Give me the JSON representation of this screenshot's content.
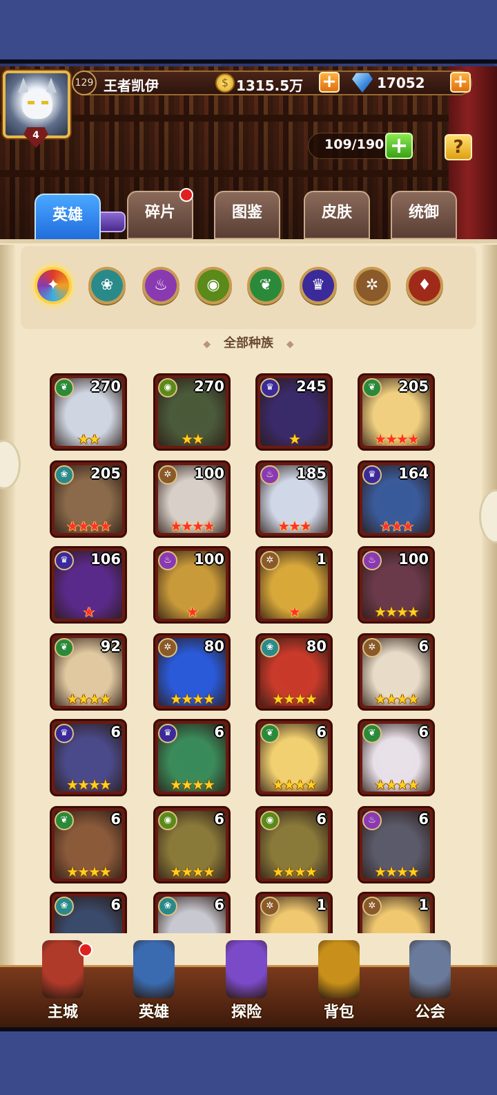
{
  "player": {
    "level": "129",
    "name": "王者凯伊",
    "avatar_rank": "4",
    "gold": "1315.5万",
    "diamonds": "17052"
  },
  "hero_capacity": "109/190",
  "help_label": "?",
  "tabs": [
    {
      "label": "英雄",
      "active": true
    },
    {
      "label": "碎片",
      "has_notification": true
    },
    {
      "label": "图鉴"
    },
    {
      "label": "皮肤"
    },
    {
      "label": "统御"
    }
  ],
  "race_filters": [
    {
      "name": "all-races",
      "icon": "✦",
      "color": "#e0562a",
      "selected": true
    },
    {
      "name": "race-teal",
      "icon": "❀",
      "color": "#2a8a8a"
    },
    {
      "name": "race-purple",
      "icon": "♨",
      "color": "#8a3ab0"
    },
    {
      "name": "race-green-eye",
      "icon": "◉",
      "color": "#5a8a1a"
    },
    {
      "name": "race-leaf",
      "icon": "❦",
      "color": "#2a8a3a"
    },
    {
      "name": "race-demon",
      "icon": "♛",
      "color": "#3a2a9a"
    },
    {
      "name": "race-light",
      "icon": "✲",
      "color": "#8a5a2a"
    },
    {
      "name": "race-dark",
      "icon": "♦",
      "color": "#a02a1a"
    }
  ],
  "selected_race_label": "全部种族",
  "heroes": [
    {
      "level": "270",
      "stars": "★★",
      "red": false,
      "faction": "❦",
      "faction_color": "#2a8a3a",
      "art": "#cfd6e2"
    },
    {
      "level": "270",
      "stars": "★★",
      "red": false,
      "faction": "◉",
      "faction_color": "#5a8a1a",
      "art": "#4a5a3a"
    },
    {
      "level": "245",
      "stars": "★",
      "red": false,
      "faction": "♛",
      "faction_color": "#3a2a9a",
      "art": "#3a2a6a"
    },
    {
      "level": "205",
      "stars": "★★★★",
      "red": true,
      "faction": "❦",
      "faction_color": "#2a8a3a",
      "art": "#f0d080"
    },
    {
      "level": "205",
      "stars": "★★★★",
      "red": true,
      "faction": "❀",
      "faction_color": "#2a8a8a",
      "art": "#8a6a4a"
    },
    {
      "level": "100",
      "stars": "★★★★",
      "red": true,
      "faction": "✲",
      "faction_color": "#8a5a2a",
      "art": "#d8d0c8"
    },
    {
      "level": "185",
      "stars": "★★★",
      "red": true,
      "faction": "♨",
      "faction_color": "#8a3ab0",
      "art": "#d0d8e8"
    },
    {
      "level": "164",
      "stars": "★★★",
      "red": true,
      "faction": "♛",
      "faction_color": "#3a2a9a",
      "art": "#3a5a9a"
    },
    {
      "level": "106",
      "stars": "★",
      "red": true,
      "faction": "♛",
      "faction_color": "#3a2a9a",
      "art": "#5a2a8a"
    },
    {
      "level": "100",
      "stars": "★",
      "red": true,
      "faction": "♨",
      "faction_color": "#8a3ab0",
      "art": "#c89a3a"
    },
    {
      "level": "1",
      "stars": "★",
      "red": true,
      "faction": "✲",
      "faction_color": "#8a5a2a",
      "art": "#d8a83a"
    },
    {
      "level": "100",
      "stars": "★★★★",
      "red": false,
      "faction": "♨",
      "faction_color": "#8a3ab0",
      "art": "#6a3a4a"
    },
    {
      "level": "92",
      "stars": "★★★★",
      "red": false,
      "faction": "❦",
      "faction_color": "#2a8a3a",
      "art": "#e0c8a0"
    },
    {
      "level": "80",
      "stars": "★★★★",
      "red": false,
      "faction": "✲",
      "faction_color": "#8a5a2a",
      "art": "#2a5ad8"
    },
    {
      "level": "80",
      "stars": "★★★★",
      "red": false,
      "faction": "❀",
      "faction_color": "#2a8a8a",
      "art": "#c83a2a"
    },
    {
      "level": "6",
      "stars": "★★★★",
      "red": false,
      "faction": "✲",
      "faction_color": "#8a5a2a",
      "art": "#e8dcc8"
    },
    {
      "level": "6",
      "stars": "★★★★",
      "red": false,
      "faction": "♛",
      "faction_color": "#3a2a9a",
      "art": "#4a4a8a"
    },
    {
      "level": "6",
      "stars": "★★★★",
      "red": false,
      "faction": "♛",
      "faction_color": "#3a2a9a",
      "art": "#3a8a5a"
    },
    {
      "level": "6",
      "stars": "★★★★",
      "red": false,
      "faction": "❦",
      "faction_color": "#2a8a3a",
      "art": "#f0d070"
    },
    {
      "level": "6",
      "stars": "★★★★",
      "red": false,
      "faction": "❦",
      "faction_color": "#2a8a3a",
      "art": "#e8e0e8"
    },
    {
      "level": "6",
      "stars": "★★★★",
      "red": false,
      "faction": "❦",
      "faction_color": "#2a8a3a",
      "art": "#8a5a3a"
    },
    {
      "level": "6",
      "stars": "★★★★",
      "red": false,
      "faction": "◉",
      "faction_color": "#5a8a1a",
      "art": "#8a7a3a"
    },
    {
      "level": "6",
      "stars": "★★★★",
      "red": false,
      "faction": "◉",
      "faction_color": "#5a8a1a",
      "art": "#8a7a3a"
    },
    {
      "level": "6",
      "stars": "★★★★",
      "red": false,
      "faction": "♨",
      "faction_color": "#8a3ab0",
      "art": "#5a5a6a"
    },
    {
      "level": "6",
      "stars": "",
      "red": false,
      "faction": "❀",
      "faction_color": "#2a8a8a",
      "art": "#3a4a6a"
    },
    {
      "level": "6",
      "stars": "",
      "red": false,
      "faction": "❀",
      "faction_color": "#2a8a8a",
      "art": "#c8c8d0"
    },
    {
      "level": "1",
      "stars": "",
      "red": false,
      "faction": "✲",
      "faction_color": "#8a5a2a",
      "art": "#f0c870"
    },
    {
      "level": "1",
      "stars": "",
      "red": false,
      "faction": "✲",
      "faction_color": "#8a5a2a",
      "art": "#f0c870"
    }
  ],
  "bottom_nav": [
    {
      "label": "主城",
      "icon": "castle-icon",
      "color": "#b03a2a",
      "badge": true
    },
    {
      "label": "英雄",
      "icon": "hero-icon",
      "color": "#3a6ab0"
    },
    {
      "label": "探险",
      "icon": "portal-icon",
      "color": "#7a4ac8"
    },
    {
      "label": "背包",
      "icon": "backpack-icon",
      "color": "#c8901a"
    },
    {
      "label": "公会",
      "icon": "guild-tower-icon",
      "color": "#6a7a9a"
    }
  ]
}
